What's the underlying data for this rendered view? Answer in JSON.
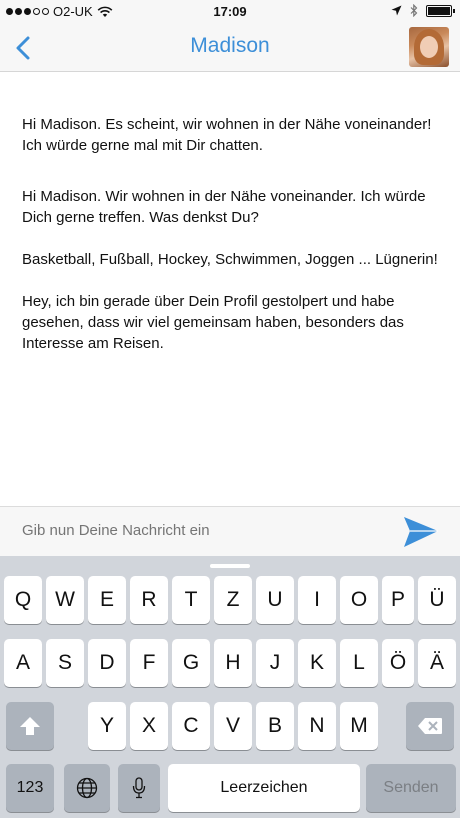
{
  "status_bar": {
    "carrier": "O2-UK",
    "time": "17:09"
  },
  "nav": {
    "title": "Madison"
  },
  "messages": [
    "Hi Madison. Es scheint, wir wohnen in der Nähe voneinander! Ich würde gerne mal mit Dir chatten.",
    "Hi Madison. Wir wohnen in der Nähe voneinander. Ich würde Dich gerne treffen. Was denkst Du?",
    "Basketball, Fußball, Hockey, Schwimmen, Joggen ... Lügnerin!",
    "Hey, ich bin gerade über Dein Profil gestolpert und habe gesehen, dass wir viel gemeinsam haben, besonders das Interesse am Reisen."
  ],
  "composer": {
    "placeholder": "Gib nun Deine Nachricht ein"
  },
  "keyboard": {
    "row1": [
      "Q",
      "W",
      "E",
      "R",
      "T",
      "Z",
      "U",
      "I",
      "O",
      "P",
      "Ü"
    ],
    "row2": [
      "A",
      "S",
      "D",
      "F",
      "G",
      "H",
      "J",
      "K",
      "L",
      "Ö",
      "Ä"
    ],
    "row3": [
      "Y",
      "X",
      "C",
      "V",
      "B",
      "N",
      "M"
    ],
    "numbers_label": "123",
    "space_label": "Leerzeichen",
    "send_label": "Senden"
  },
  "icons": {
    "back": "chevron-left-icon",
    "send": "paper-plane-icon",
    "shift": "shift-icon",
    "delete": "backspace-icon",
    "globe": "globe-icon",
    "mic": "microphone-icon",
    "wifi": "wifi-icon",
    "location": "location-arrow-icon",
    "bluetooth": "bluetooth-icon",
    "battery": "battery-icon"
  },
  "colors": {
    "accent": "#3d8fd8"
  }
}
